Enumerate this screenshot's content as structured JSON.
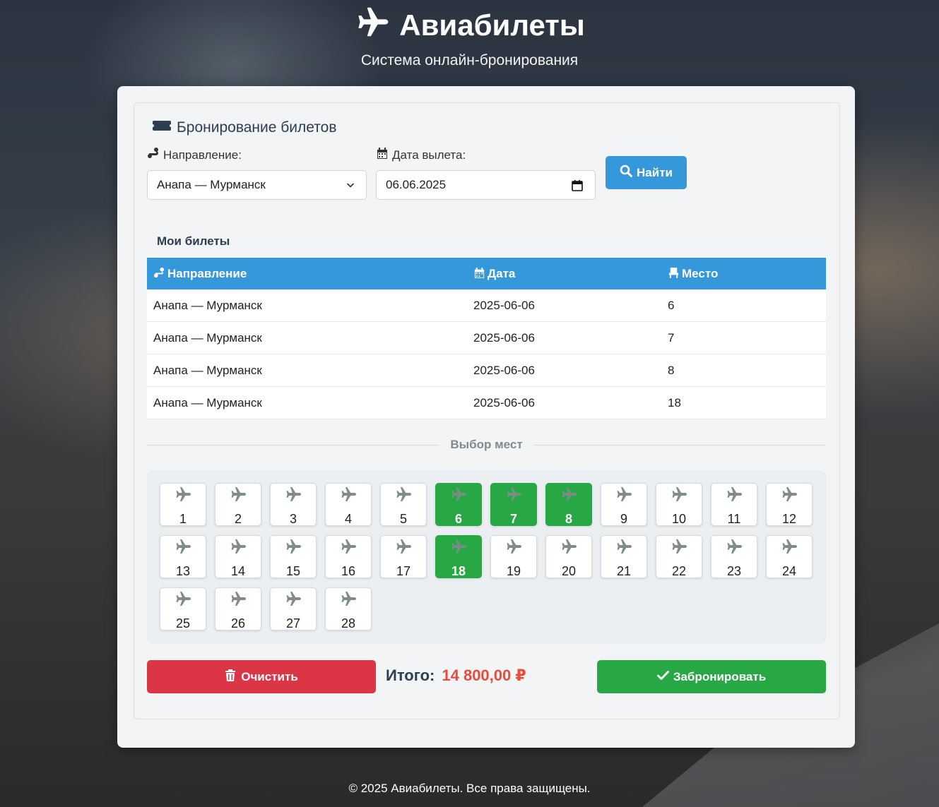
{
  "header": {
    "title": "Авиабилеты",
    "subtitle": "Система онлайн-бронирования"
  },
  "booking": {
    "section_title": "Бронирование билетов",
    "direction_label": "Направление:",
    "direction_value": "Анапа — Мурманск",
    "date_label": "Дата вылета:",
    "date_value": "06.06.2025",
    "find_button": "Найти"
  },
  "my_tickets": {
    "title": "Мои билеты",
    "columns": [
      "Направление",
      "Дата",
      "Место"
    ],
    "rows": [
      [
        "Анапа — Мурманск",
        "2025-06-06",
        "6"
      ],
      [
        "Анапа — Мурманск",
        "2025-06-06",
        "7"
      ],
      [
        "Анапа — Мурманск",
        "2025-06-06",
        "8"
      ],
      [
        "Анапа — Мурманск",
        "2025-06-06",
        "18"
      ]
    ]
  },
  "seats": {
    "divider_label": "Выбор мест",
    "numbers": [
      "1",
      "2",
      "3",
      "4",
      "5",
      "6",
      "7",
      "8",
      "9",
      "10",
      "11",
      "12",
      "13",
      "14",
      "15",
      "16",
      "17",
      "18",
      "19",
      "20",
      "21",
      "22",
      "23",
      "24",
      "25",
      "26",
      "27",
      "28"
    ],
    "selected": [
      "6",
      "7",
      "8",
      "18"
    ]
  },
  "actions": {
    "clear_button": "Очистить",
    "total_label": "Итого:",
    "total_amount": "14 800,00 ₽",
    "book_button": "Забронировать"
  },
  "footer": {
    "text": "© 2025 Авиабилеты. Все права защищены."
  },
  "colors": {
    "primary": "#3498db",
    "danger": "#dc3545",
    "success": "#28a745",
    "price": "#e74c3c"
  },
  "icons": {
    "title": "plane-icon",
    "section": "ticket-icon",
    "direction": "route-icon",
    "date": "calendar-icon",
    "seat_header": "chair-icon",
    "find": "search-icon",
    "clear": "trash-icon",
    "book": "check-icon",
    "seat": "plane-icon"
  }
}
